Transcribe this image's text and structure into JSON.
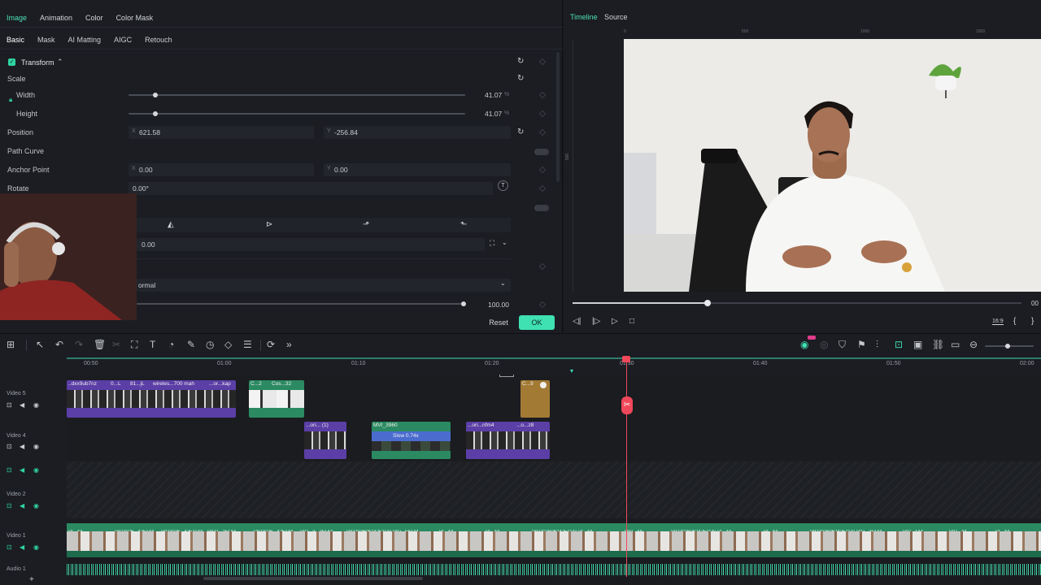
{
  "top_tabs": [
    "Image",
    "Animation",
    "Color",
    "Color Mask"
  ],
  "sub_tabs": [
    "Basic",
    "Mask",
    "AI Matting",
    "AIGC",
    "Retouch"
  ],
  "transform": {
    "section_label": "Transform",
    "scale_label": "Scale",
    "width_label": "Width",
    "width_value": "41.07",
    "width_unit": "%",
    "width_level": 0.08,
    "height_label": "Height",
    "height_value": "41.07",
    "height_unit": "%",
    "height_level": 0.08,
    "position_label": "Position",
    "position_x": "621.58",
    "position_y": "-256.84",
    "path_curve_label": "Path Curve",
    "anchor_label": "Anchor Point",
    "anchor_x": "0.00",
    "anchor_y": "0.00",
    "rotate_label": "Rotate",
    "rotate_value": "0.00°",
    "axis_x": "X",
    "axis_y": "Y"
  },
  "compositing": {
    "flip_value": "0.00",
    "blend_mode": "ormal",
    "opacity_value": "100.00",
    "opacity_level": 1.0
  },
  "buttons": {
    "reset": "Reset",
    "ok": "OK"
  },
  "preview": {
    "tabs": [
      "Timeline",
      "Source"
    ],
    "ruler": [
      "0",
      "500",
      "1000",
      "1500"
    ],
    "ruler_v": "500",
    "progress": 0.3,
    "aspect": "16:9",
    "time_partial": "00"
  },
  "timeline": {
    "ruler": [
      "00:50",
      "01:00",
      "01:10",
      "01:20",
      "01:30",
      "01:40",
      "01:50",
      "02:00"
    ],
    "tracks": {
      "video5": "Video 5",
      "video4": "Video 4",
      "video2": "Video 2",
      "video1": "Video 1",
      "audio1": "Audio 1"
    },
    "v5_clips": [
      "..dxx9ub7nz",
      "0...L",
      "81...jL",
      "wireles...700 mah",
      "...or...kap",
      "C...2",
      "Cos...32",
      "C...9"
    ],
    "v4_clips": [
      "...ori... (1)",
      "MVI_3960",
      "Slow 0.74x",
      "...ori...nfm4",
      "...o...z8"
    ],
    "v1_clips": [
      "VI...44",
      "VID2026...425144",
      "VID2026...4251144",
      "VID2...25144",
      "VID2026...425144",
      "VID...3...25144",
      "VID20260624251144",
      "VID...56144",
      "VI...44",
      "VI...44",
      "VID20260624251144",
      "VI...44",
      "VID...44",
      "VID20260624251144",
      "VI...44",
      "VI...44",
      "VID20260624251144",
      "VID...25144",
      "VID...144",
      "VID...44",
      "VI...44"
    ],
    "colors": {
      "playhead": "#f0485a",
      "accent": "#3fe0b2",
      "purple": "#5b3ea6",
      "green": "#2b8a62"
    }
  }
}
